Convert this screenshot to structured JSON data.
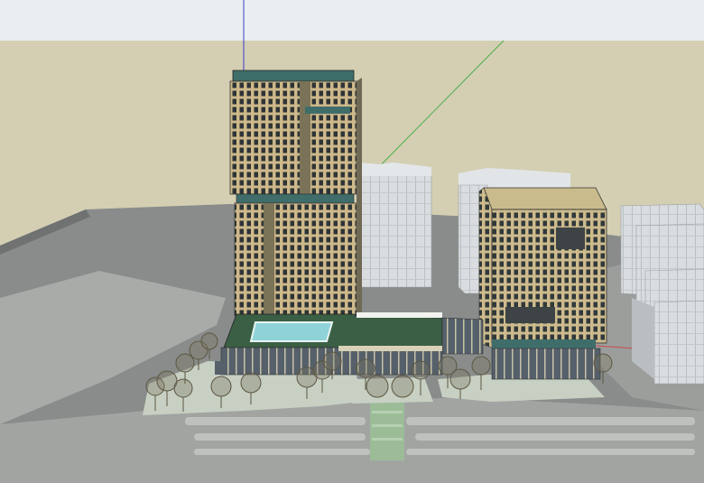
{
  "scene": {
    "kind": "3d-architectural-model",
    "colors": {
      "sky": "#e9eff0",
      "ground": "#d4cfb4",
      "site": "#8c8f8e",
      "road": "#a6a8a6",
      "facade": "#ccb98a",
      "window": "#2d3436",
      "glass": "#3f6e6a",
      "pool": "#8fd3d8",
      "roof_green": "#3a5f45",
      "lawn": "#c9d2c4",
      "background_buildings": "#d5d9dc",
      "tree": "#6b6550",
      "axis_blue": "#3a3acd",
      "axis_green": "#4fae4f",
      "axis_red": "#c84a4a"
    }
  }
}
